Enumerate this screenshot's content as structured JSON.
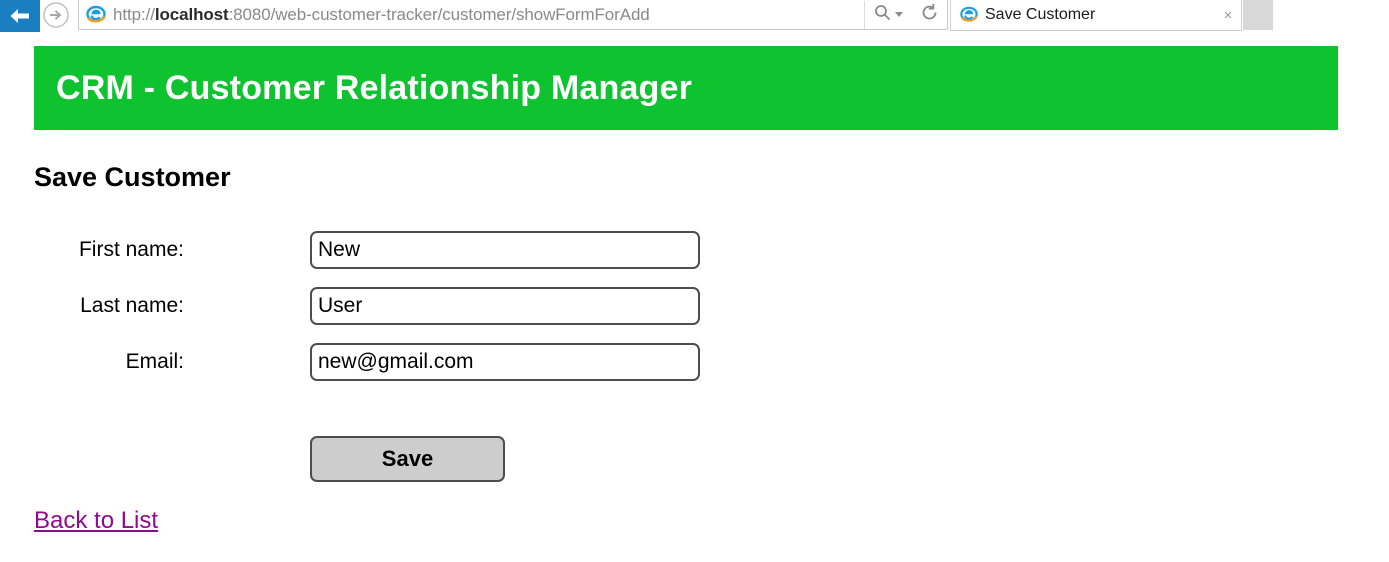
{
  "browser": {
    "back_icon": "back-arrow-icon",
    "forward_icon": "forward-arrow-icon",
    "favicon": "internet-explorer-icon",
    "url_scheme": "http://",
    "url_host": "localhost",
    "url_rest": ":8080/web-customer-tracker/customer/showFormForAdd",
    "url_full": "http://localhost:8080/web-customer-tracker/customer/showFormForAdd",
    "search_icon": "search-icon",
    "search_caret_icon": "chevron-down-icon",
    "refresh_icon": "refresh-icon",
    "tab": {
      "favicon": "internet-explorer-icon",
      "title": "Save Customer",
      "close_label": "×"
    },
    "new_tab_label": ""
  },
  "app": {
    "banner_title": "CRM - Customer Relationship Manager",
    "banner_color": "#0fc22f",
    "page_heading": "Save Customer"
  },
  "form": {
    "fields": [
      {
        "label": "First name:",
        "value": "New",
        "placeholder": "",
        "name": "first-name"
      },
      {
        "label": "Last name:",
        "value": "User",
        "placeholder": "",
        "name": "last-name"
      },
      {
        "label": "Email:",
        "value": "new@gmail.com",
        "placeholder": "",
        "name": "email"
      }
    ],
    "save_label": "Save"
  },
  "links": {
    "back_to_list": "Back to List",
    "link_color": "#8e0a8e"
  }
}
